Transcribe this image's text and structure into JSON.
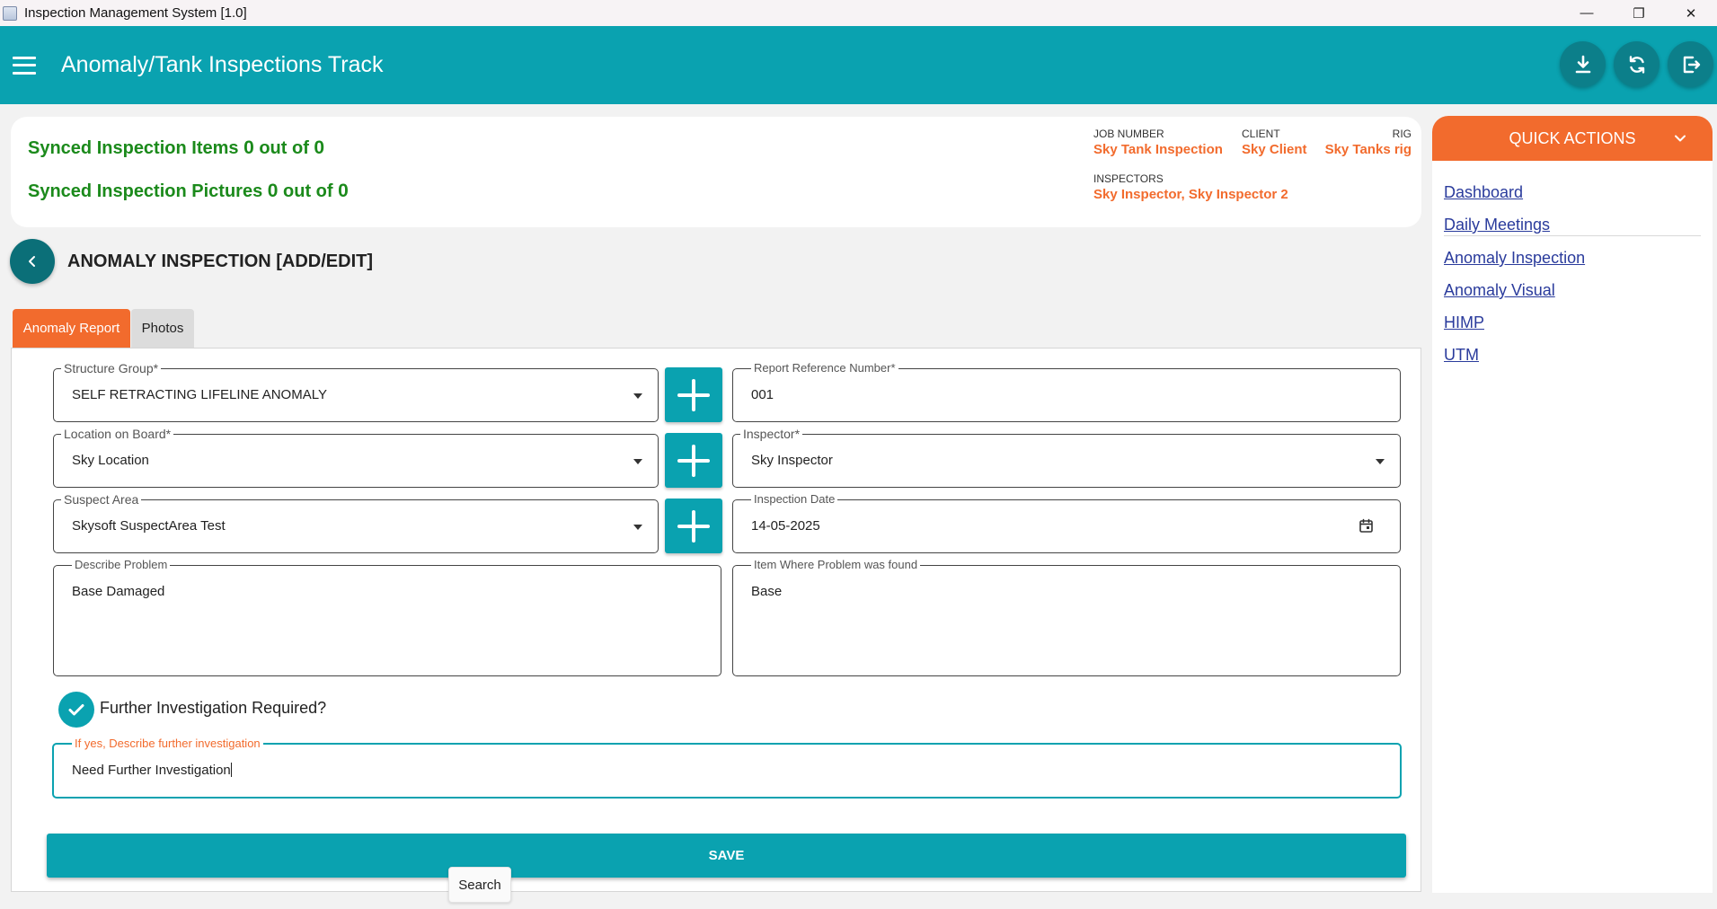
{
  "window": {
    "title": "Inspection Management System [1.0]",
    "controls": [
      "—",
      "❐",
      "✕"
    ]
  },
  "appbar": {
    "title": "Anomaly/Tank Inspections Track",
    "actions": [
      "download-icon",
      "sync-icon",
      "logout-icon"
    ]
  },
  "sync": {
    "items_label": "Synced Inspection Items",
    "items_synced": "0",
    "items_out_of": "out of",
    "items_total": "0",
    "pictures_label": "Synced Inspection Pictures",
    "pictures_synced": "0",
    "pictures_out_of": "out of",
    "pictures_total": "0"
  },
  "job": {
    "job_number_label": "JOB NUMBER",
    "job_number": "Sky Tank Inspection",
    "client_label": "CLIENT",
    "client": "Sky Client",
    "rig_label": "RIG",
    "rig": "Sky Tanks rig",
    "inspectors_label": "INSPECTORS",
    "inspectors": "Sky Inspector, Sky Inspector 2"
  },
  "page": {
    "title": "ANOMALY INSPECTION [ADD/EDIT]"
  },
  "tabs": [
    {
      "label": "Anomaly Report",
      "active": true
    },
    {
      "label": "Photos",
      "active": false
    }
  ],
  "form": {
    "structure_group": {
      "label": "Structure Group*",
      "value": "SELF RETRACTING LIFELINE ANOMALY"
    },
    "location_on_board": {
      "label": "Location on Board*",
      "value": "Sky Location"
    },
    "suspect_area": {
      "label": "Suspect Area",
      "value": "Skysoft SuspectArea Test"
    },
    "describe_problem": {
      "label": "Describe Problem",
      "value": "Base Damaged"
    },
    "report_reference_number": {
      "label": "Report Reference Number*",
      "value": "001"
    },
    "inspector": {
      "label": "Inspector*",
      "value": "Sky Inspector"
    },
    "inspection_date": {
      "label": "Inspection Date",
      "value": "14-05-2025"
    },
    "item_where_problem_found": {
      "label": "Item Where Problem was found",
      "value": "Base"
    },
    "further_investigation": {
      "label": "Further Investigation Required?",
      "checked": true
    },
    "further_description": {
      "label": "If yes, Describe further investigation",
      "value": "Need Further Investigation"
    },
    "save_label": "SAVE"
  },
  "tooltip": {
    "text": "Search"
  },
  "quick_actions": {
    "title": "QUICK ACTIONS",
    "links": [
      "Dashboard",
      "Daily Meetings",
      "Anomaly Inspection",
      "Anomaly Visual",
      "HIMP",
      "UTM"
    ]
  },
  "colors": {
    "primary": "#0aa2b0",
    "accent": "#f26b2d",
    "synced_green": "#1b8a1b",
    "link": "#2a3b9c"
  }
}
